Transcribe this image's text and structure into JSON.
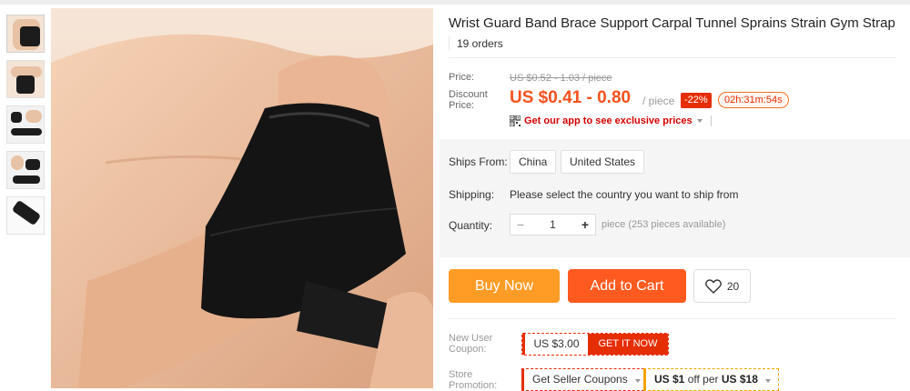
{
  "product": {
    "title": "Wrist Guard Band Brace Support Carpal Tunnel Sprains Strain Gym Strap",
    "orders": "19 orders"
  },
  "price": {
    "price_label": "Price:",
    "original": "US $0.52 - 1.03 / piece",
    "discount_label_1": "Discount",
    "discount_label_2": "Price:",
    "current": "US $0.41 - 0.80",
    "unit": "/ piece",
    "discount_pct": "-22%",
    "countdown": "02h:31m:54s",
    "app_promo": "Get our app to see exclusive prices"
  },
  "shipping": {
    "ships_from_label": "Ships From:",
    "origins": [
      "China",
      "United States"
    ],
    "shipping_label": "Shipping:",
    "shipping_text": "Please select the country you want to ship from",
    "quantity_label": "Quantity:",
    "quantity_value": "1",
    "minus": "−",
    "plus": "+",
    "available": "piece (253 pieces available)"
  },
  "actions": {
    "buy_now": "Buy Now",
    "add_to_cart": "Add to Cart",
    "wishlist_count": "20"
  },
  "coupons": {
    "new_user_label_1": "New User",
    "new_user_label_2": "Coupon:",
    "coupon_amount": "US $3.00",
    "get_it_now": "GET IT NOW",
    "store_label_1": "Store",
    "store_label_2": "Promotion:",
    "seller_coupons": "Get Seller Coupons",
    "store_offer_amount": "US $1",
    "store_offer_mid": "off per",
    "store_offer_threshold": "US $18"
  },
  "colors": {
    "accent_orange": "#ff5a1f",
    "buy_now": "#ff9c26",
    "price_red": "#f4511e",
    "badge_red": "#e62e04"
  },
  "icons": [
    "qr-code-icon",
    "heart-icon",
    "caret-down-icon"
  ]
}
